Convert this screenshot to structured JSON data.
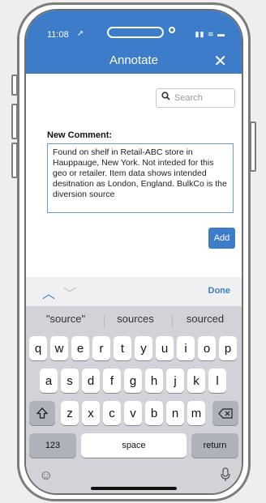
{
  "status": {
    "time": "11:08",
    "location_glyph": "➚",
    "right_glyphs": "▮▮ ≋ ▬"
  },
  "header": {
    "title": "Annotate",
    "close_label": "✕"
  },
  "search": {
    "placeholder": "Search"
  },
  "comment": {
    "label": "New Comment:",
    "text": "Found on shelf in Retail-ABC store in Hauppauge, New York. Not inteded for this geo or retailer. Item data shows intended desitnation as London, England. BulkCo is the diversion source"
  },
  "add_button": {
    "label": "Add"
  },
  "keyboard": {
    "accessory": {
      "done_label": "Done"
    },
    "suggestions": [
      "\"source\"",
      "sources",
      "sourced"
    ],
    "row1": [
      "q",
      "w",
      "e",
      "r",
      "t",
      "y",
      "u",
      "i",
      "o",
      "p"
    ],
    "row2": [
      "a",
      "s",
      "d",
      "f",
      "g",
      "h",
      "j",
      "k",
      "l"
    ],
    "row3": [
      "z",
      "x",
      "c",
      "v",
      "b",
      "n",
      "m"
    ],
    "numbers_label": "123",
    "space_label": "space",
    "return_label": "return"
  },
  "colors": {
    "accent": "#3c7cc9",
    "keyboard_bg": "#d1d3d9"
  }
}
